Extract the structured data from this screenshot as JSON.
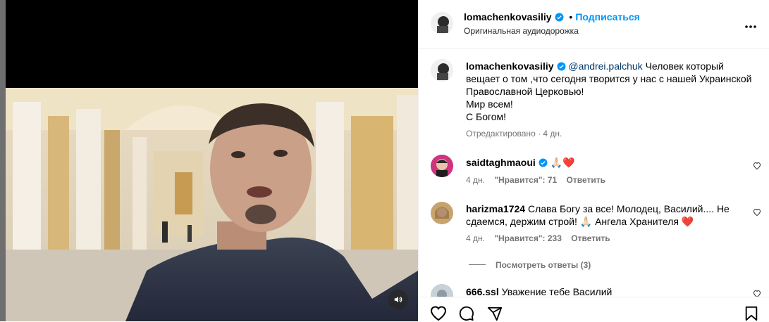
{
  "header": {
    "username": "lomachenkovasiliy",
    "separator": "•",
    "follow_label": "Подписаться",
    "audio_label": "Оригинальная аудиодорожка"
  },
  "caption": {
    "username": "lomachenkovasiliy",
    "mention": "@andrei.palchuk",
    "line1_rest": " Человек который",
    "line2": "вещает о том ,что сегодня творится у нас с нашей Украинской",
    "line3": "Православной Церковью!",
    "line4": "Мир всем!",
    "line5": "С Богом!",
    "meta": "Отредактировано · 4 дн."
  },
  "comments": [
    {
      "username": "saidtaghmaoui",
      "text": "🙏🏻❤️",
      "time": "4 дн.",
      "likes": "\"Нравится\": 71",
      "reply": "Ответить"
    },
    {
      "username": "harizma1724",
      "text": "Слава Богу за все! Молодец, Василий.... Не сдаемся, держим строй! 🙏🏻 Ангела Хранителя ❤️",
      "time": "4 дн.",
      "likes": "\"Нравится\": 233",
      "reply": "Ответить",
      "view_replies": "Посмотреть ответы (3)"
    },
    {
      "username": "666.ssl",
      "text": "Уважение тебе Василий"
    }
  ],
  "colors": {
    "accent": "#0095f6",
    "verified": "#0095f6",
    "muted": "#737373",
    "heart": "#ed4956"
  }
}
